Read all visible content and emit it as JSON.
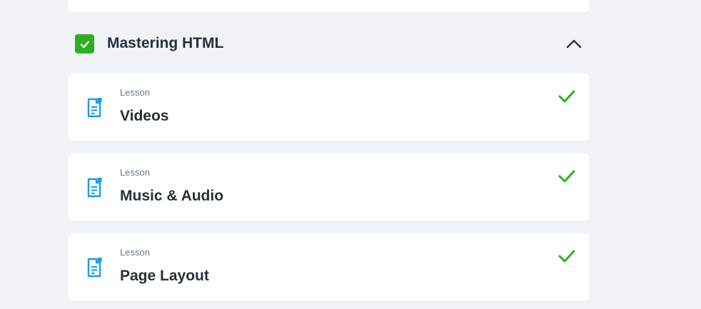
{
  "section": {
    "title": "Mastering HTML",
    "completed": true,
    "expanded": true,
    "accent_color": "#2fae25"
  },
  "lessons": [
    {
      "type": "Lesson",
      "title": "Videos",
      "completed": true,
      "icon": "document-icon"
    },
    {
      "type": "Lesson",
      "title": "Music & Audio",
      "completed": true,
      "icon": "document-icon"
    },
    {
      "type": "Lesson",
      "title": "Page Layout",
      "completed": true,
      "icon": "document-icon"
    }
  ],
  "colors": {
    "background": "#f0f3f6",
    "card": "#ffffff",
    "icon_blue": "#1e9be0",
    "check_green": "#2fae25",
    "text_dark": "#27313d",
    "text_muted": "#6b7a89"
  }
}
